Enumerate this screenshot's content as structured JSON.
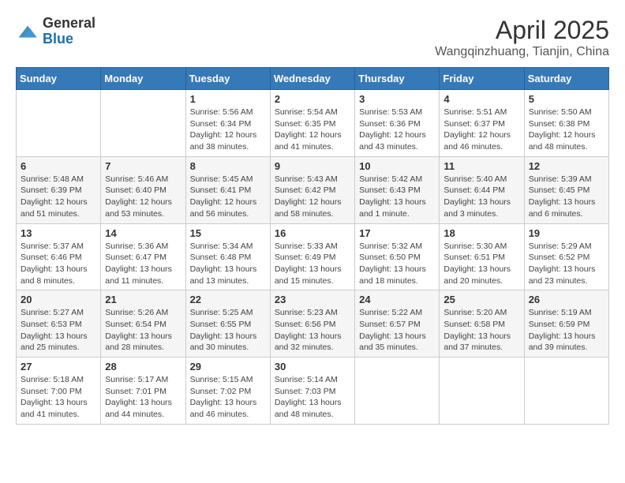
{
  "logo": {
    "general": "General",
    "blue": "Blue"
  },
  "title": "April 2025",
  "subtitle": "Wangqinzhuang, Tianjin, China",
  "days_of_week": [
    "Sunday",
    "Monday",
    "Tuesday",
    "Wednesday",
    "Thursday",
    "Friday",
    "Saturday"
  ],
  "weeks": [
    [
      {
        "day": "",
        "info": ""
      },
      {
        "day": "",
        "info": ""
      },
      {
        "day": "1",
        "info": "Sunrise: 5:56 AM\nSunset: 6:34 PM\nDaylight: 12 hours and 38 minutes."
      },
      {
        "day": "2",
        "info": "Sunrise: 5:54 AM\nSunset: 6:35 PM\nDaylight: 12 hours and 41 minutes."
      },
      {
        "day": "3",
        "info": "Sunrise: 5:53 AM\nSunset: 6:36 PM\nDaylight: 12 hours and 43 minutes."
      },
      {
        "day": "4",
        "info": "Sunrise: 5:51 AM\nSunset: 6:37 PM\nDaylight: 12 hours and 46 minutes."
      },
      {
        "day": "5",
        "info": "Sunrise: 5:50 AM\nSunset: 6:38 PM\nDaylight: 12 hours and 48 minutes."
      }
    ],
    [
      {
        "day": "6",
        "info": "Sunrise: 5:48 AM\nSunset: 6:39 PM\nDaylight: 12 hours and 51 minutes."
      },
      {
        "day": "7",
        "info": "Sunrise: 5:46 AM\nSunset: 6:40 PM\nDaylight: 12 hours and 53 minutes."
      },
      {
        "day": "8",
        "info": "Sunrise: 5:45 AM\nSunset: 6:41 PM\nDaylight: 12 hours and 56 minutes."
      },
      {
        "day": "9",
        "info": "Sunrise: 5:43 AM\nSunset: 6:42 PM\nDaylight: 12 hours and 58 minutes."
      },
      {
        "day": "10",
        "info": "Sunrise: 5:42 AM\nSunset: 6:43 PM\nDaylight: 13 hours and 1 minute."
      },
      {
        "day": "11",
        "info": "Sunrise: 5:40 AM\nSunset: 6:44 PM\nDaylight: 13 hours and 3 minutes."
      },
      {
        "day": "12",
        "info": "Sunrise: 5:39 AM\nSunset: 6:45 PM\nDaylight: 13 hours and 6 minutes."
      }
    ],
    [
      {
        "day": "13",
        "info": "Sunrise: 5:37 AM\nSunset: 6:46 PM\nDaylight: 13 hours and 8 minutes."
      },
      {
        "day": "14",
        "info": "Sunrise: 5:36 AM\nSunset: 6:47 PM\nDaylight: 13 hours and 11 minutes."
      },
      {
        "day": "15",
        "info": "Sunrise: 5:34 AM\nSunset: 6:48 PM\nDaylight: 13 hours and 13 minutes."
      },
      {
        "day": "16",
        "info": "Sunrise: 5:33 AM\nSunset: 6:49 PM\nDaylight: 13 hours and 15 minutes."
      },
      {
        "day": "17",
        "info": "Sunrise: 5:32 AM\nSunset: 6:50 PM\nDaylight: 13 hours and 18 minutes."
      },
      {
        "day": "18",
        "info": "Sunrise: 5:30 AM\nSunset: 6:51 PM\nDaylight: 13 hours and 20 minutes."
      },
      {
        "day": "19",
        "info": "Sunrise: 5:29 AM\nSunset: 6:52 PM\nDaylight: 13 hours and 23 minutes."
      }
    ],
    [
      {
        "day": "20",
        "info": "Sunrise: 5:27 AM\nSunset: 6:53 PM\nDaylight: 13 hours and 25 minutes."
      },
      {
        "day": "21",
        "info": "Sunrise: 5:26 AM\nSunset: 6:54 PM\nDaylight: 13 hours and 28 minutes."
      },
      {
        "day": "22",
        "info": "Sunrise: 5:25 AM\nSunset: 6:55 PM\nDaylight: 13 hours and 30 minutes."
      },
      {
        "day": "23",
        "info": "Sunrise: 5:23 AM\nSunset: 6:56 PM\nDaylight: 13 hours and 32 minutes."
      },
      {
        "day": "24",
        "info": "Sunrise: 5:22 AM\nSunset: 6:57 PM\nDaylight: 13 hours and 35 minutes."
      },
      {
        "day": "25",
        "info": "Sunrise: 5:20 AM\nSunset: 6:58 PM\nDaylight: 13 hours and 37 minutes."
      },
      {
        "day": "26",
        "info": "Sunrise: 5:19 AM\nSunset: 6:59 PM\nDaylight: 13 hours and 39 minutes."
      }
    ],
    [
      {
        "day": "27",
        "info": "Sunrise: 5:18 AM\nSunset: 7:00 PM\nDaylight: 13 hours and 41 minutes."
      },
      {
        "day": "28",
        "info": "Sunrise: 5:17 AM\nSunset: 7:01 PM\nDaylight: 13 hours and 44 minutes."
      },
      {
        "day": "29",
        "info": "Sunrise: 5:15 AM\nSunset: 7:02 PM\nDaylight: 13 hours and 46 minutes."
      },
      {
        "day": "30",
        "info": "Sunrise: 5:14 AM\nSunset: 7:03 PM\nDaylight: 13 hours and 48 minutes."
      },
      {
        "day": "",
        "info": ""
      },
      {
        "day": "",
        "info": ""
      },
      {
        "day": "",
        "info": ""
      }
    ]
  ]
}
